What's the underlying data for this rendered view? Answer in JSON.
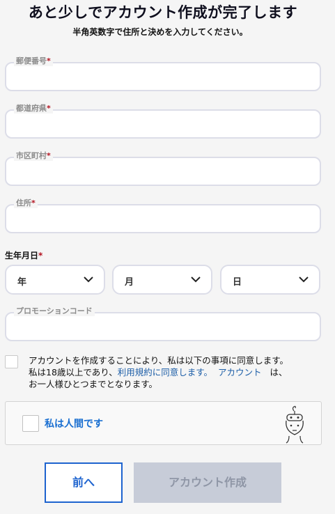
{
  "header": {
    "title": "あと少しでアカウント作成が完了します",
    "subtitle": "半角英数字で住所と決めを入力してください。"
  },
  "form": {
    "postal_code": {
      "label": "郵便番号",
      "required_mark": "*",
      "value": ""
    },
    "prefecture": {
      "label": "都道府県",
      "required_mark": "*",
      "value": ""
    },
    "city": {
      "label": "市区町村",
      "required_mark": "*",
      "value": ""
    },
    "address": {
      "label": "住所",
      "required_mark": "*",
      "value": ""
    },
    "birthdate": {
      "label": "生年月日",
      "required_mark": "*",
      "year": "年",
      "month": "月",
      "day": "日"
    },
    "promo_code": {
      "label": "プロモーションコード",
      "value": ""
    }
  },
  "agreement": {
    "checked": false,
    "line1": "アカウントを作成することにより、私は以下の事項に同意します。",
    "line2_prefix": "私は18歳以上であり、",
    "terms_link": "利用規約に同意します。",
    "account_link": "アカウント",
    "line2_suffix": "は、",
    "line3": "お一人様ひとつまでとなります。"
  },
  "captcha": {
    "label": "私は人間です",
    "checked": false
  },
  "buttons": {
    "back": "前へ",
    "create": "アカウント作成"
  },
  "colors": {
    "primary": "#1d63cf",
    "required": "#b3121f",
    "link": "#1e5fa8",
    "disabled_bg": "#c7ccd8",
    "disabled_text": "#8f96a6"
  },
  "icons": {
    "chevron": "chevron-down-icon",
    "captcha_logo": "captcha-robot-logo"
  }
}
